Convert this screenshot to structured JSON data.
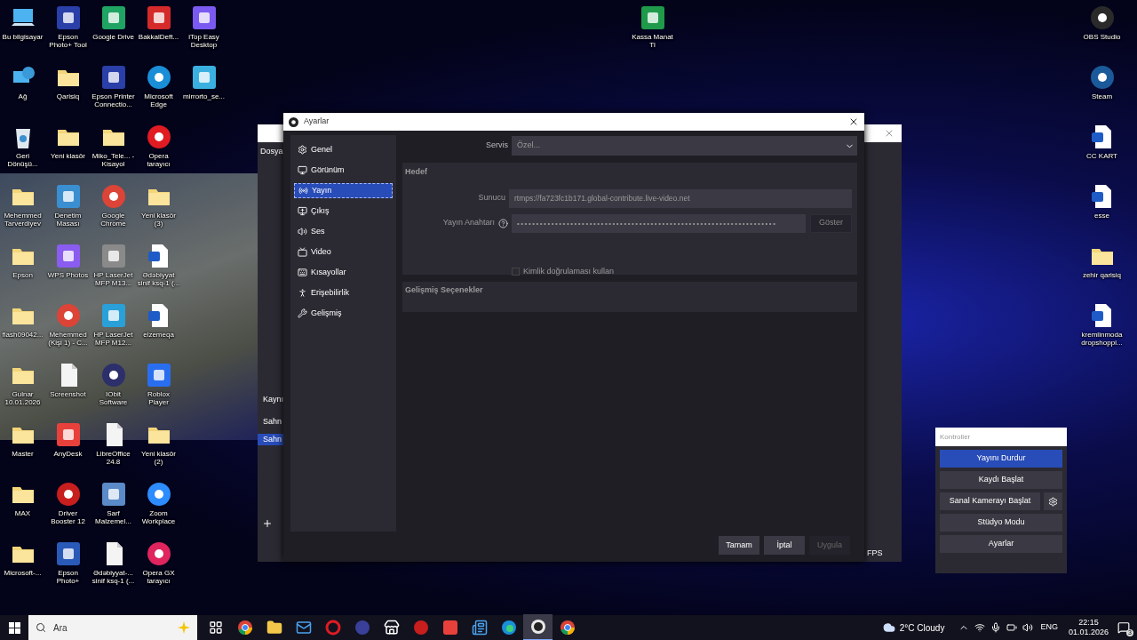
{
  "desktop": {
    "left_columns": [
      [
        {
          "label": "Bu bilgisayar",
          "kind": "pc"
        },
        {
          "label": "Ağ",
          "kind": "network"
        },
        {
          "label": "Geri Dönüşü...",
          "kind": "trash"
        },
        {
          "label": "Mehemmed Tarverdiyev",
          "kind": "folder"
        },
        {
          "label": "Epson",
          "kind": "folder"
        },
        {
          "label": "flash09042...",
          "kind": "folder"
        },
        {
          "label": "Gulnar 10.01.2026",
          "kind": "folder"
        },
        {
          "label": "Master",
          "kind": "folder"
        },
        {
          "label": "MAX",
          "kind": "folder"
        },
        {
          "label": "Microsoft-...",
          "kind": "folder"
        }
      ],
      [
        {
          "label": "Epson Photo+ Tool",
          "kind": "app",
          "color": "#2a3fa8"
        },
        {
          "label": "Qarisiq",
          "kind": "folder"
        },
        {
          "label": "Yeni klasör",
          "kind": "folder"
        },
        {
          "label": "Denetim Masası",
          "kind": "app",
          "color": "#3a8fd0"
        },
        {
          "label": "WPS Photos",
          "kind": "app",
          "color": "#8a5cf0"
        },
        {
          "label": "Mehemmed (Kişi 1) - C...",
          "kind": "round",
          "color": "#db4437"
        },
        {
          "label": "Screenshot",
          "kind": "doc"
        },
        {
          "label": "AnyDesk",
          "kind": "app",
          "color": "#e8413b"
        },
        {
          "label": "Driver Booster 12",
          "kind": "round",
          "color": "#c81e1e"
        },
        {
          "label": "Epson Photo+",
          "kind": "app",
          "color": "#2a5ab8"
        }
      ],
      [
        {
          "label": "Google Drive",
          "kind": "app",
          "color": "#1fa463"
        },
        {
          "label": "Epson Printer Connectio...",
          "kind": "app",
          "color": "#2a3fa8"
        },
        {
          "label": "Miko_Tele... - Kisayol",
          "kind": "folder"
        },
        {
          "label": "Google Chrome",
          "kind": "round",
          "color": "#db4437"
        },
        {
          "label": "HP LaserJet MFP M13...",
          "kind": "app",
          "color": "#8a8a8a"
        },
        {
          "label": "HP LaserJet MFP M12...",
          "kind": "app",
          "color": "#2aa0d8"
        },
        {
          "label": "IObit Software",
          "kind": "round",
          "color": "#2c2f6a"
        },
        {
          "label": "LibreOffice 24.8",
          "kind": "doc"
        },
        {
          "label": "Sarf Malzemel...",
          "kind": "app",
          "color": "#5a8ac8"
        },
        {
          "label": "Ədəbiyyat-... sinif ksq-1 (...",
          "kind": "doc"
        }
      ],
      [
        {
          "label": "BakkalDeft...",
          "kind": "app",
          "color": "#d42a2a"
        },
        {
          "label": "Microsoft Edge",
          "kind": "round",
          "color": "#1a8fd8"
        },
        {
          "label": "Opera tarayıcı",
          "kind": "round",
          "color": "#e01b22"
        },
        {
          "label": "Yeni klasör (3)",
          "kind": "folder"
        },
        {
          "label": "Ədəbiyyat sinif ksq-1 (...",
          "kind": "word"
        },
        {
          "label": "elzemeqa",
          "kind": "word"
        },
        {
          "label": "Roblox Player",
          "kind": "app",
          "color": "#2a6ef0"
        },
        {
          "label": "Yeni klasör (2)",
          "kind": "folder"
        },
        {
          "label": "Zoom Workplace",
          "kind": "round",
          "color": "#2d8cff"
        },
        {
          "label": "Opera GX tarayıcı",
          "kind": "round",
          "color": "#e0245e"
        }
      ],
      [
        {
          "label": "iTop Easy Desktop",
          "kind": "app",
          "color": "#7a5af0"
        },
        {
          "label": "mirrorto_se...",
          "kind": "app",
          "color": "#3ab0e0"
        }
      ]
    ],
    "middle_icons": [
      {
        "label": "Kassa Manat Tl",
        "kind": "app",
        "color": "#1f9a4a"
      }
    ],
    "right_icons": [
      {
        "label": "OBS Studio",
        "kind": "round",
        "color": "#2a2a2a"
      },
      {
        "label": "Steam",
        "kind": "round",
        "color": "#1a5a9a"
      },
      {
        "label": "CC KART",
        "kind": "word"
      },
      {
        "label": "esse",
        "kind": "word"
      },
      {
        "label": "zehir qarisiq",
        "kind": "folder"
      },
      {
        "label": "kremlinmoda dropshoppi...",
        "kind": "word"
      }
    ]
  },
  "obs_main": {
    "menu": "Dosya",
    "texts": [
      "Kaynı",
      "Sahn"
    ],
    "scene": "Sahn",
    "status": "FPS"
  },
  "settings": {
    "title": "Ayarlar",
    "sidebar": [
      {
        "label": "Genel",
        "selected": false
      },
      {
        "label": "Görünüm",
        "selected": false
      },
      {
        "label": "Yayın",
        "selected": true
      },
      {
        "label": "Çıkış",
        "selected": false
      },
      {
        "label": "Ses",
        "selected": false
      },
      {
        "label": "Video",
        "selected": false
      },
      {
        "label": "Kısayollar",
        "selected": false
      },
      {
        "label": "Erişebilirlik",
        "selected": false
      },
      {
        "label": "Gelişmiş",
        "selected": false
      }
    ],
    "service": {
      "label": "Servis",
      "value": "Özel..."
    },
    "destination": {
      "title": "Hedef",
      "server": {
        "label": "Sunucu",
        "value": "rtmps://fa723fc1b171.global-contribute.live-video.net"
      },
      "key": {
        "label": "Yayın Anahtarı",
        "value": "••••••••••••••••••••••••••••••••••••••••••••••••••••••••••••••••••••",
        "button": "Göster"
      },
      "auth": {
        "label": "Kimlik doğrulaması kullan",
        "checked": false
      }
    },
    "advanced": {
      "title": "Gelişmiş Seçenekler"
    },
    "buttons": [
      {
        "label": "Tamam",
        "disabled": false
      },
      {
        "label": "İptal",
        "disabled": false
      },
      {
        "label": "Uygula",
        "disabled": true
      }
    ]
  },
  "controls": {
    "title": "Kontroller",
    "buttons": [
      {
        "label": "Yayını Durdur",
        "active": true,
        "gear": false
      },
      {
        "label": "Kaydı Başlat",
        "active": false,
        "gear": false
      },
      {
        "label": "Sanal Kamerayı Başlat",
        "active": false,
        "gear": true
      },
      {
        "label": "Stüdyo Modu",
        "active": false,
        "gear": false
      },
      {
        "label": "Ayarlar",
        "active": false,
        "gear": false
      }
    ]
  },
  "taskbar": {
    "search": "Ara",
    "apps": [
      {
        "kind": "taskview",
        "selected": false
      },
      {
        "kind": "chrome",
        "selected": false
      },
      {
        "kind": "folder",
        "selected": false
      },
      {
        "kind": "mail",
        "selected": false
      },
      {
        "kind": "opera",
        "selected": false
      },
      {
        "kind": "iobit",
        "selected": false
      },
      {
        "kind": "store",
        "selected": false
      },
      {
        "kind": "game",
        "selected": false
      },
      {
        "kind": "wps",
        "selected": false
      },
      {
        "kind": "news",
        "selected": false
      },
      {
        "kind": "edge",
        "selected": false
      },
      {
        "kind": "obs",
        "selected": true
      },
      {
        "kind": "chrome",
        "selected": false
      }
    ],
    "weather": "2°C Cloudy",
    "language": "ENG",
    "time": "22:15",
    "date": "01.01.2026",
    "notifications": "3"
  }
}
